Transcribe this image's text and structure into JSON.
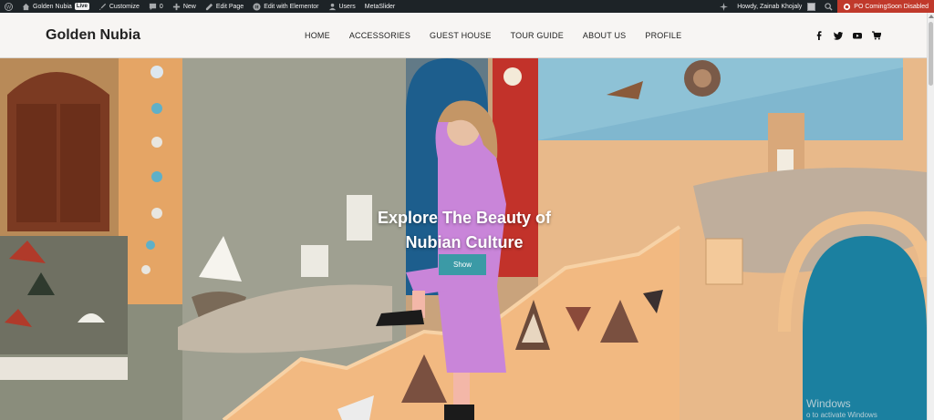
{
  "admin_bar": {
    "site_name": "Golden Nubia",
    "live_badge": "Live",
    "customize": "Customize",
    "comments_count": "0",
    "new": "New",
    "edit_page": "Edit Page",
    "edit_elementor": "Edit with Elementor",
    "users": "Users",
    "metaslider": "MetaSlider",
    "howdy": "Howdy, Zainab Khojaly",
    "coming_soon": "PO ComingSoon Disabled"
  },
  "header": {
    "site_title": "Golden Nubia",
    "nav": [
      "HOME",
      "ACCESSORIES",
      "GUEST HOUSE",
      "TOUR GUIDE",
      "ABOUT US",
      "PROFILE"
    ],
    "social_icons": [
      "facebook-icon",
      "twitter-icon",
      "youtube-icon",
      "cart-icon"
    ]
  },
  "hero": {
    "title_line1": "Explore The Beauty of",
    "title_line2": "Nubian Culture",
    "button_label": "Show",
    "button_color": "#3b9aa6"
  },
  "watermark": {
    "title": "Windows",
    "subtitle": "o to activate Windows"
  }
}
